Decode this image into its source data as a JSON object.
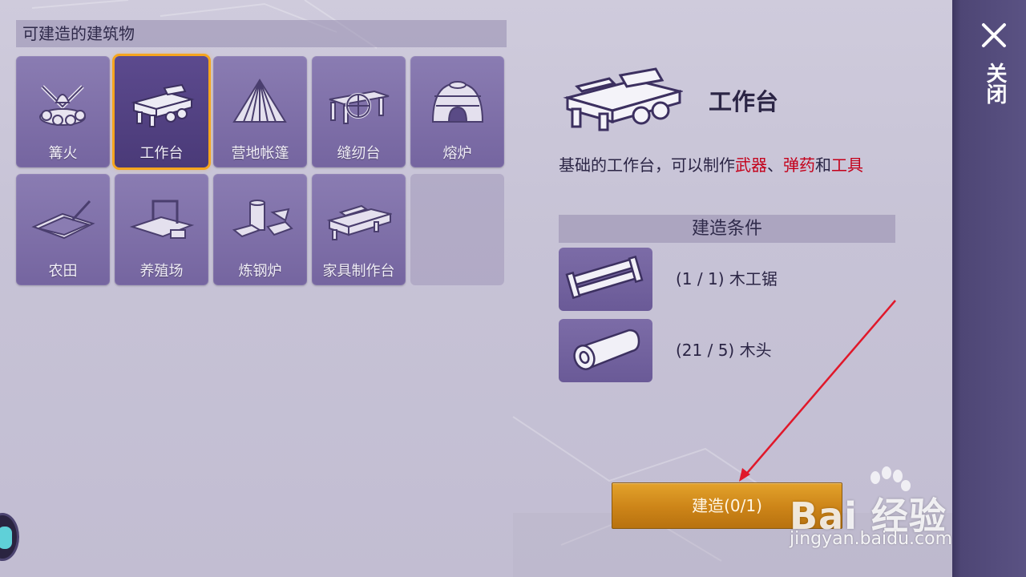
{
  "left_panel": {
    "header": "可建造的建筑物",
    "buildings": [
      {
        "label": "篝火",
        "icon": "campfire-icon",
        "selected": false
      },
      {
        "label": "工作台",
        "icon": "workbench-icon",
        "selected": true
      },
      {
        "label": "营地帐篷",
        "icon": "tent-icon",
        "selected": false
      },
      {
        "label": "缝纫台",
        "icon": "sewing-table-icon",
        "selected": false
      },
      {
        "label": "熔炉",
        "icon": "furnace-icon",
        "selected": false
      },
      {
        "label": "农田",
        "icon": "farmland-icon",
        "selected": false
      },
      {
        "label": "养殖场",
        "icon": "ranch-icon",
        "selected": false
      },
      {
        "label": "炼钢炉",
        "icon": "steel-furnace-icon",
        "selected": false
      },
      {
        "label": "家具制作台",
        "icon": "furniture-bench-icon",
        "selected": false
      }
    ]
  },
  "detail": {
    "title": "工作台",
    "desc_prefix": "基础的工作台，可以制作",
    "desc_hl1": "武器",
    "desc_sep": "、",
    "desc_hl2": "弹药",
    "desc_and": "和",
    "desc_hl3": "工具",
    "requirements_header": "建造条件",
    "requirements": [
      {
        "text": "(1 / 1) 木工锯",
        "icon": "saw-icon"
      },
      {
        "text": "(21 / 5) 木头",
        "icon": "log-icon"
      }
    ]
  },
  "build_button": "建造(0/1)",
  "close_label": "关闭",
  "watermark": {
    "brand": "Bai 经验",
    "url": "jingyan.baidu.com"
  },
  "colors": {
    "accent_orange": "#f6a51d",
    "highlight_red": "#c4001a",
    "tile_purple": "#7c6ca7"
  }
}
